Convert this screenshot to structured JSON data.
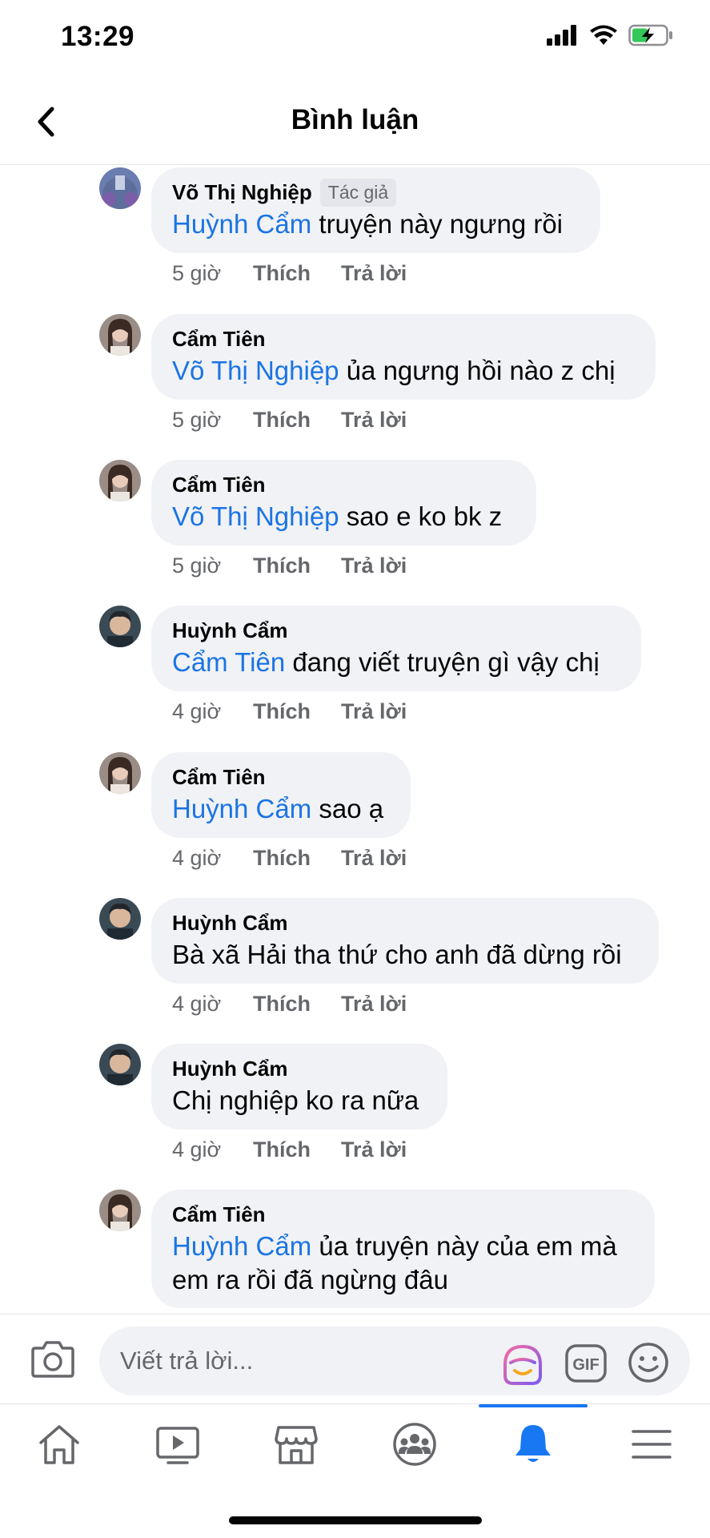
{
  "status_bar": {
    "time": "13:29"
  },
  "header": {
    "title": "Bình luận"
  },
  "comments": [
    {
      "author": "Võ Thị Nghiệp",
      "badge": "Tác giả",
      "mention": "Huỳnh Cẩm",
      "text": " truyện này ngưng rồi",
      "time": "5 giờ",
      "like": "Thích",
      "reply": "Trả lời"
    },
    {
      "author": "Cẩm Tiên",
      "mention": "Võ Thị Nghiệp",
      "text": " ủa ngưng hồi nào z chị",
      "time": "5 giờ",
      "like": "Thích",
      "reply": "Trả lời"
    },
    {
      "author": "Cẩm Tiên",
      "mention": "Võ Thị Nghiệp",
      "text": " sao e ko bk z",
      "time": "5 giờ",
      "like": "Thích",
      "reply": "Trả lời"
    },
    {
      "author": "Huỳnh Cẩm",
      "mention": "Cẩm Tiên",
      "text": " đang viết truyện gì vậy chị",
      "time": "4 giờ",
      "like": "Thích",
      "reply": "Trả lời"
    },
    {
      "author": "Cẩm Tiên",
      "mention": "Huỳnh Cẩm",
      "text": " sao ạ",
      "time": "4 giờ",
      "like": "Thích",
      "reply": "Trả lời"
    },
    {
      "author": "Huỳnh Cẩm",
      "mention": "",
      "text": "Bà xã Hải tha thứ cho anh đã dừng rồi",
      "time": "4 giờ",
      "like": "Thích",
      "reply": "Trả lời"
    },
    {
      "author": "Huỳnh Cẩm",
      "mention": "",
      "text": "Chị nghiệp ko ra nữa",
      "time": "4 giờ",
      "like": "Thích",
      "reply": "Trả lời"
    },
    {
      "author": "Cẩm Tiên",
      "mention": "Huỳnh Cẩm",
      "text": " ủa truyện này của em mà",
      "text_line2": "em ra rồi đã ngừng đâu"
    }
  ],
  "composer": {
    "placeholder": "Viết trả lời...",
    "gif_label": "GIF"
  },
  "nav": {
    "items": [
      "home-icon",
      "watch-icon",
      "marketplace-icon",
      "groups-icon",
      "notifications-icon",
      "menu-icon"
    ],
    "active": "notifications-icon",
    "active_color": "#1877f2"
  },
  "colors": {
    "mention": "#1b74e4",
    "bubble": "#f0f2f5",
    "meta": "#65676b"
  }
}
